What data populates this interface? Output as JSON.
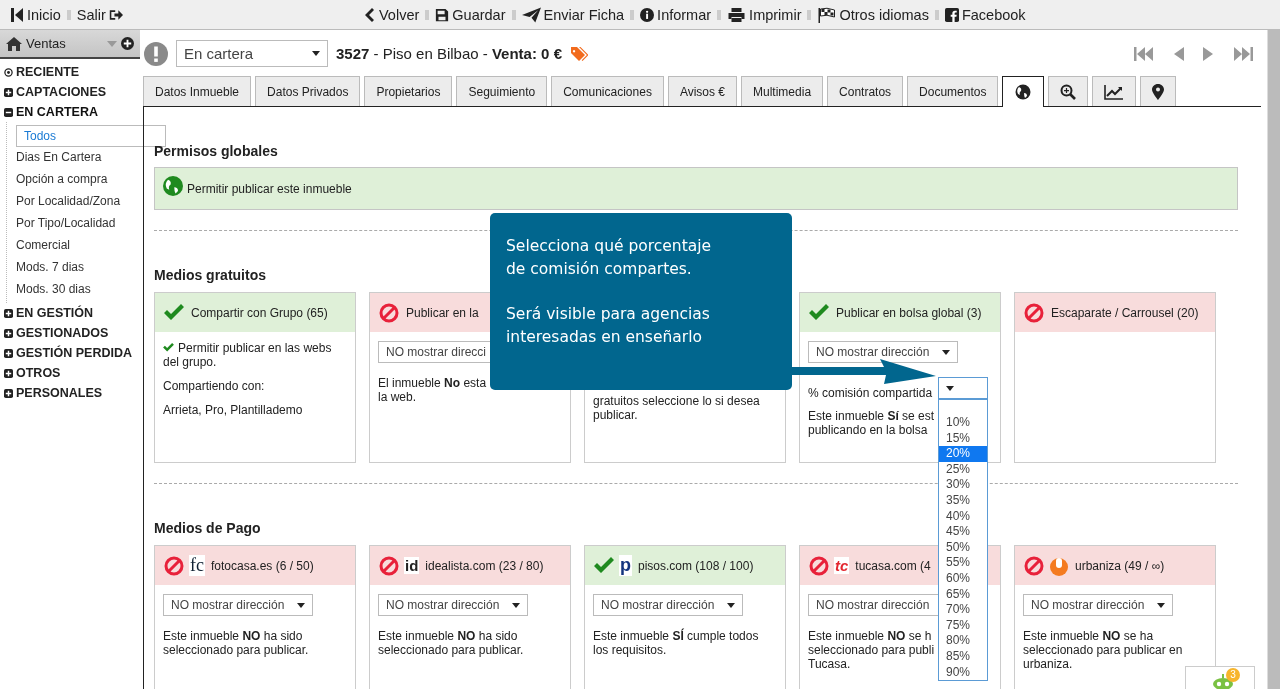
{
  "toolbar": {
    "left": [
      {
        "kind": "home",
        "label": "Inicio"
      },
      {
        "kind": "exit",
        "label": "Salir"
      }
    ],
    "center": [
      {
        "kind": "back",
        "label": "Volver"
      },
      {
        "kind": "save",
        "label": "Guardar"
      },
      {
        "kind": "send",
        "label": "Enviar Ficha"
      },
      {
        "kind": "info",
        "label": "Informar"
      },
      {
        "kind": "print",
        "label": "Imprimir"
      },
      {
        "kind": "flag",
        "label": "Otros idiomas"
      },
      {
        "kind": "facebook",
        "label": "Facebook"
      }
    ]
  },
  "sidebar": {
    "title": "Ventas",
    "groups": [
      {
        "kind": "recent",
        "label": "RECIENTE"
      },
      {
        "kind": "group",
        "label": "CAPTACIONES",
        "expanded": false
      },
      {
        "kind": "group",
        "label": "EN CARTERA",
        "expanded": true,
        "children": [
          {
            "label": "Todos",
            "selected": true
          },
          {
            "label": "Dias En Cartera",
            "selected": false
          },
          {
            "label": "Opción a compra",
            "selected": false
          },
          {
            "label": "Por Localidad/Zona",
            "selected": false
          },
          {
            "label": "Por Tipo/Localidad",
            "selected": false
          },
          {
            "label": "Comercial",
            "selected": false
          },
          {
            "label": "Mods. 7 dias",
            "selected": false
          },
          {
            "label": "Mods. 30 dias",
            "selected": false
          }
        ]
      },
      {
        "kind": "group",
        "label": "EN GESTIÓN",
        "expanded": false
      },
      {
        "kind": "group",
        "label": "GESTIONADOS",
        "expanded": false
      },
      {
        "kind": "group",
        "label": "GESTIÓN PERDIDA",
        "expanded": false
      },
      {
        "kind": "group",
        "label": "OTROS",
        "expanded": false
      },
      {
        "kind": "group",
        "label": "PERSONALES",
        "expanded": false
      }
    ]
  },
  "header": {
    "status_select": "En cartera",
    "title": "**3527** - Piso en Bilbao - **Venta: 0 €**"
  },
  "tabs": [
    {
      "kind": "text",
      "label": "Datos Inmueble",
      "selected": false
    },
    {
      "kind": "text",
      "label": "Datos Privados",
      "selected": false
    },
    {
      "kind": "text",
      "label": "Propietarios",
      "selected": false
    },
    {
      "kind": "text",
      "label": "Seguimiento",
      "selected": false
    },
    {
      "kind": "text",
      "label": "Comunicaciones",
      "selected": false
    },
    {
      "kind": "text",
      "label": "Avisos €",
      "selected": false
    },
    {
      "kind": "text",
      "label": "Multimedia",
      "selected": false
    },
    {
      "kind": "text",
      "label": "Contratos",
      "selected": false
    },
    {
      "kind": "text",
      "label": "Documentos",
      "selected": false
    },
    {
      "kind": "globe",
      "selected": true
    },
    {
      "kind": "zoom",
      "selected": false
    },
    {
      "kind": "chart",
      "selected": false
    },
    {
      "kind": "pin",
      "selected": false
    }
  ],
  "global_permissions": {
    "title": "Permisos globales",
    "label": "Permitir publicar este inmueble"
  },
  "sections": [
    {
      "title": "Medios gratuitos",
      "cards": [
        {
          "kind": "allowed",
          "title": "Compartir con Grupo (65)",
          "note": {
            "text": "Permitir publicar en las webs del grupo.",
            "checked": true
          },
          "paragraphs": [
            "Compartiendo con:",
            "Arrieta, Pro, Plantillademo"
          ]
        },
        {
          "kind": "blocked",
          "title": "Publicar en la",
          "select": "NO mostrar direcci",
          "paragraphs": [
            "El inmueble **No** esta\nla web."
          ]
        },
        {
          "kind": "covered",
          "paragraphs": [
            "gratuitos seleccione lo si desea\npublicar."
          ]
        },
        {
          "kind": "allowed",
          "title": "Publicar en bolsa global (3)",
          "select": "NO mostrar dirección",
          "commission": {
            "label": "% comisión compartida"
          },
          "paragraphs": [
            "Este inmueble **Sí** se est\npublicando en la bolsa"
          ]
        },
        {
          "kind": "blocked",
          "title": "Escaparate / Carrousel (20)"
        }
      ]
    },
    {
      "title": "Medios de Pago",
      "cards": [
        {
          "kind": "blocked",
          "logo": {
            "kind": "fotocasa",
            "text": "fc"
          },
          "title": "fotocasa.es (6 / 50)",
          "select": "NO mostrar dirección",
          "paragraphs": [
            "Este inmueble **NO** ha sido\nseleccionado para publicar."
          ]
        },
        {
          "kind": "blocked",
          "logo": {
            "kind": "idealista",
            "text": "id"
          },
          "title": "idealista.com (23 / 80)",
          "select": "NO mostrar dirección",
          "paragraphs": [
            "Este inmueble **NO** ha sido\nseleccionado para publicar."
          ]
        },
        {
          "kind": "allowed",
          "logo": {
            "kind": "pisos",
            "text": "p"
          },
          "title": "pisos.com (108 / 100)",
          "select": "NO mostrar dirección",
          "paragraphs": [
            "Este inmueble **SÍ** cumple todos\nlos requisitos."
          ]
        },
        {
          "kind": "blocked",
          "logo": {
            "kind": "tucasa",
            "text": "tc"
          },
          "title": "tucasa.com (4",
          "select": "NO mostrar dirección",
          "paragraphs": [
            "Este inmueble **NO** se h\nseleccionado para publi\nTucasa."
          ]
        },
        {
          "kind": "blocked",
          "logo": {
            "kind": "urbaniza"
          },
          "title": "urbaniza (49 / ∞)",
          "select": "NO mostrar dirección",
          "paragraphs": [
            "Este inmueble **NO** se ha\nseleccionado para publicar en\nurbaniza."
          ]
        }
      ]
    }
  ],
  "commission_options": [
    {
      "label": "10%",
      "selected": false
    },
    {
      "label": "15%",
      "selected": false
    },
    {
      "label": "20%",
      "selected": true
    },
    {
      "label": "25%",
      "selected": false
    },
    {
      "label": "30%",
      "selected": false
    },
    {
      "label": "35%",
      "selected": false
    },
    {
      "label": "40%",
      "selected": false
    },
    {
      "label": "45%",
      "selected": false
    },
    {
      "label": "50%",
      "selected": false
    },
    {
      "label": "55%",
      "selected": false
    },
    {
      "label": "60%",
      "selected": false
    },
    {
      "label": "65%",
      "selected": false
    },
    {
      "label": "70%",
      "selected": false
    },
    {
      "label": "75%",
      "selected": false
    },
    {
      "label": "80%",
      "selected": false
    },
    {
      "label": "85%",
      "selected": false
    },
    {
      "label": "90%",
      "selected": false
    }
  ],
  "tooltip": {
    "paragraphs": [
      "Selecciona qué porcentaje\nde comisión compartes.",
      "Será visible para agencias\ninteresadas en enseñarlo"
    ]
  },
  "chat_widget": {
    "badge": "3"
  }
}
